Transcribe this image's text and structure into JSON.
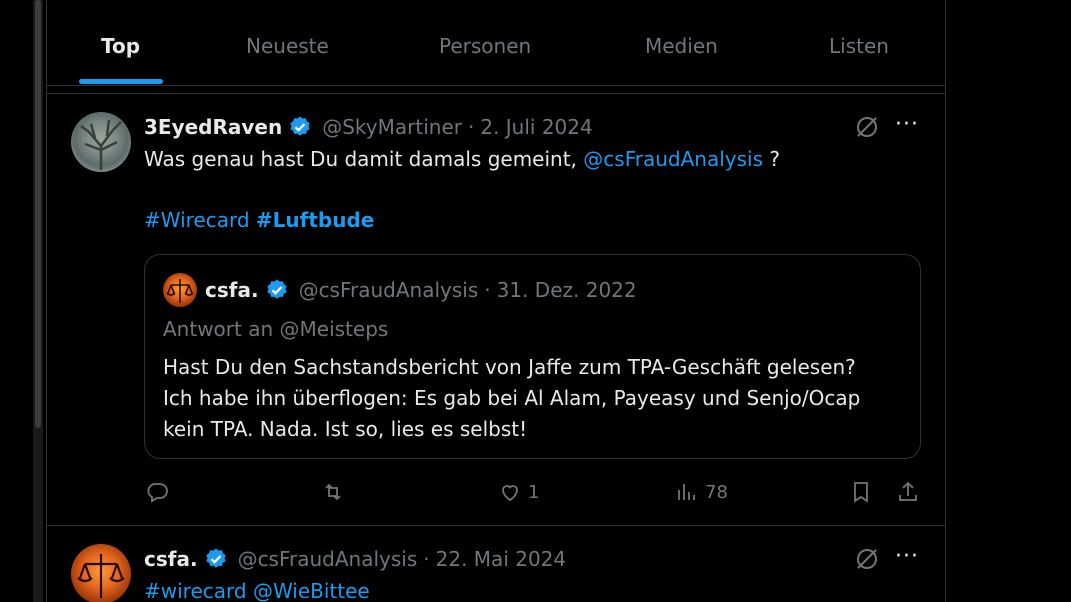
{
  "tabs": [
    "Top",
    "Neueste",
    "Personen",
    "Medien",
    "Listen"
  ],
  "tweet1": {
    "name": "3EyedRaven",
    "handle": "@SkyMartiner",
    "dot": "·",
    "date": "2. Juli 2024",
    "text_prefix": "Was genau hast Du damit damals gemeint, ",
    "mention": "@csFraudAnalysis",
    "text_suffix": " ?",
    "hashtag1": "#Wirecard",
    "hashtag2": "#Luftbude",
    "quote": {
      "name": "csfa.",
      "handle": "@csFraudAnalysis",
      "dot": "·",
      "date": "31. Dez. 2022",
      "reply_to": "Antwort an @Meisteps",
      "lines": [
        "Hast Du den Sachstandsbericht von Jaffe zum TPA-Geschäft gelesen?",
        "Ich habe ihn überflogen: Es gab bei Al Alam, Payeasy und Senjo/Ocap",
        "kein TPA. Nada. Ist so, lies es selbst!"
      ]
    },
    "likes": "1",
    "views": "78"
  },
  "tweet2": {
    "name": "csfa.",
    "handle": "@csFraudAnalysis",
    "dot": "·",
    "date": "22. Mai 2024",
    "hashtag": "#wirecard",
    "mention": "@WieBittee"
  },
  "icons": {
    "more": "···",
    "accent": "#1d9bf0",
    "muted": "#71767b"
  }
}
